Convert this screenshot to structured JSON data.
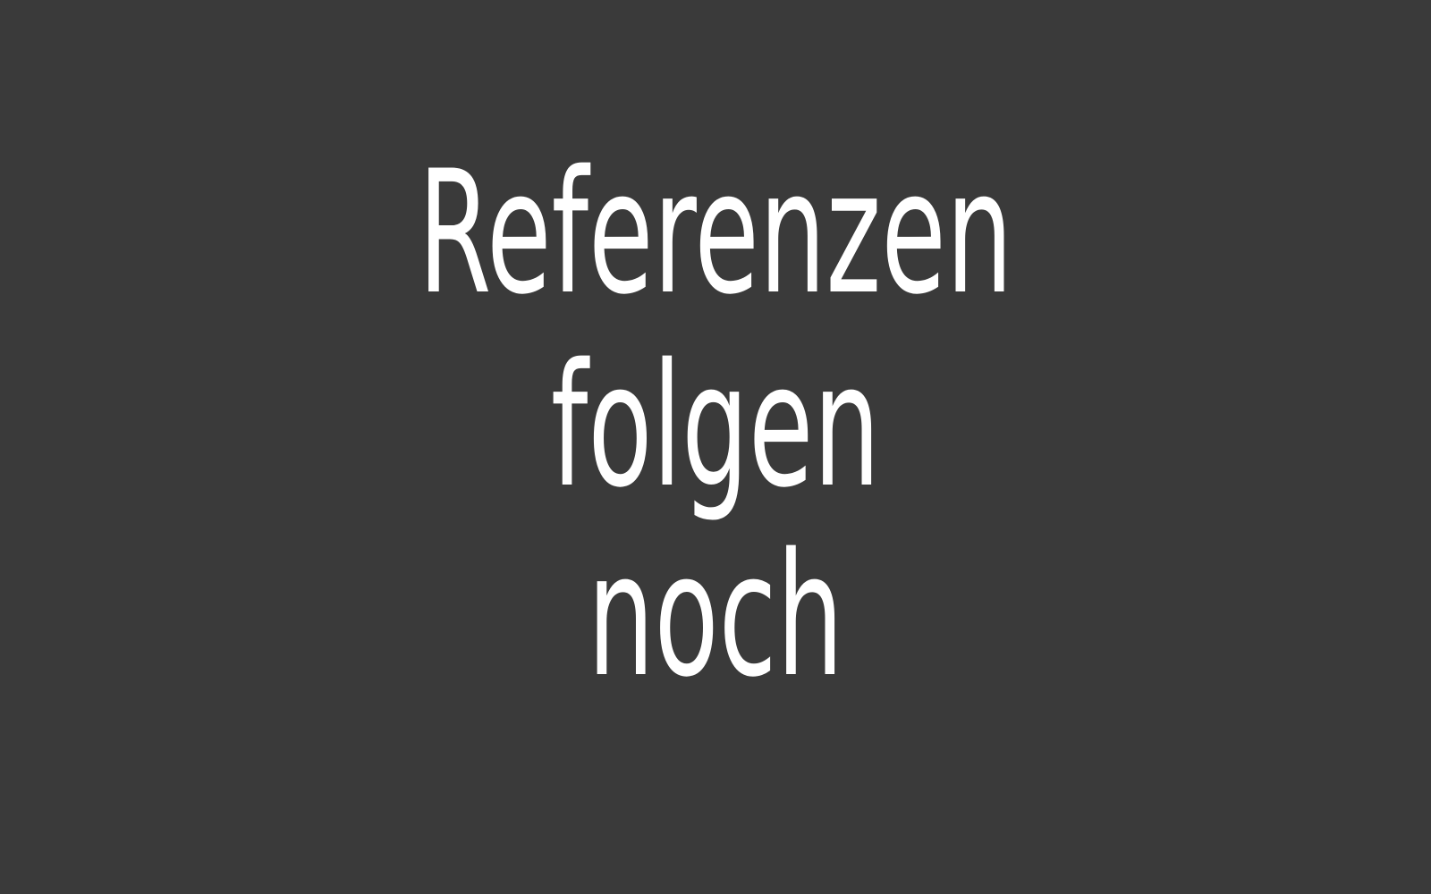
{
  "background_color": "#3a3a3a",
  "text_color": "#ffffff",
  "message": {
    "line_1": "Referenzen",
    "line_2": "folgen",
    "line_3": "noch"
  }
}
